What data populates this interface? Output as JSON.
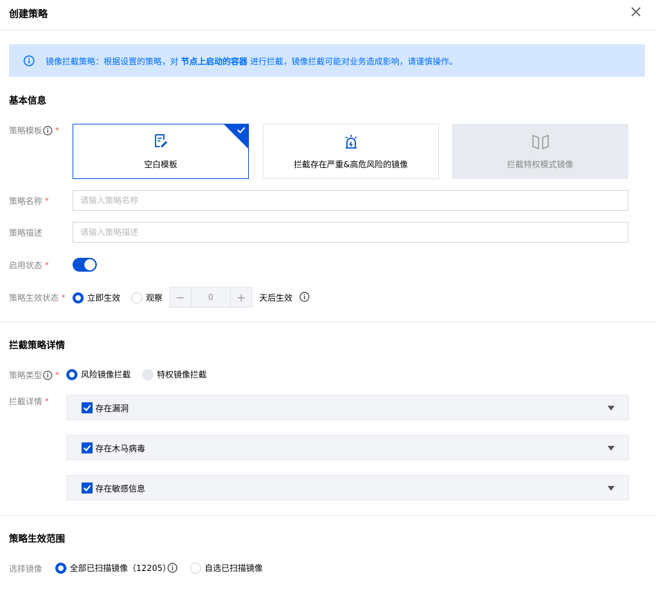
{
  "dialog": {
    "title": "创建策略"
  },
  "alert": {
    "text_before": "镜像拦截策略：根据设置的策略，对",
    "text_bold": "节点上启动的容器",
    "text_after": "进行拦截，镜像拦截可能对业务造成影响，请谨慎操作。"
  },
  "basic": {
    "title": "基本信息",
    "template_label": "策略模板",
    "templates": [
      {
        "label": "空白模板",
        "icon": "edit-document-icon",
        "state": "selected"
      },
      {
        "label": "拦截存在严重&高危风险的镜像",
        "icon": "alarm-light-icon",
        "state": "normal"
      },
      {
        "label": "拦截特权模式镜像",
        "icon": "privileged-mode-icon",
        "state": "disabled"
      }
    ],
    "name_label": "策略名称",
    "name_placeholder": "请输入策略名称",
    "name_value": "",
    "desc_label": "策略描述",
    "desc_placeholder": "请输入策略描述",
    "desc_value": "",
    "enable_label": "启用状态",
    "enabled": true,
    "effect_label": "策略生效状态",
    "effect_options": [
      "立即生效",
      "观察"
    ],
    "effect_selected": "立即生效",
    "stepper_minus": "−",
    "stepper_plus": "+",
    "stepper_value": "0",
    "days_suffix": "天后生效"
  },
  "detail": {
    "title": "拦截策略详情",
    "type_label": "策略类型",
    "type_options": [
      "风险镜像拦截",
      "特权镜像拦截"
    ],
    "type_selected": "风险镜像拦截",
    "detail_label": "拦截详情",
    "items": [
      {
        "label": "存在漏洞",
        "checked": true
      },
      {
        "label": "存在木马病毒",
        "checked": true
      },
      {
        "label": "存在敏感信息",
        "checked": true
      }
    ]
  },
  "scope": {
    "title": "策略生效范围",
    "select_label": "选择镜像",
    "options": [
      "全部已扫描镜像（12205）",
      "自选已扫描镜像"
    ],
    "selected": "全部已扫描镜像（12205）"
  },
  "colors": {
    "primary": "#0052d9",
    "alert_bg": "#d5e7ff",
    "alert_text": "#006eff",
    "required": "#e54545"
  }
}
